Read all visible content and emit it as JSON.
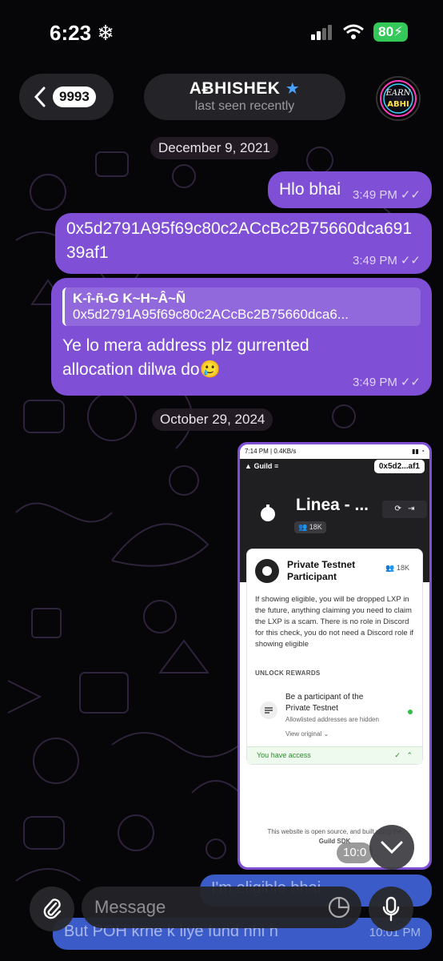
{
  "status_bar": {
    "time": "6:23",
    "battery": "80"
  },
  "header": {
    "back_count": "9993",
    "contact_name": "AɃHISHEK",
    "contact_status": "last seen recently",
    "avatar_text": "EARN ABHI"
  },
  "dates": [
    "December 9, 2021",
    "October 29, 2024"
  ],
  "messages": [
    {
      "text": "Hlo bhai",
      "time": "3:49 PM"
    },
    {
      "text": "0x5d2791A95f69c80c2ACcBc2B75660dca69139af1",
      "time": "3:49 PM"
    },
    {
      "reply_name": "K-î-ñ-G K~H~Â~Ñ",
      "reply_text": "0x5d2791A95f69c80c2ACcBc2B75660dca6...",
      "text": "Ye lo mera address plz gurrented allocation dilwa do🥲",
      "time": "3:49 PM"
    }
  ],
  "image_message": {
    "time": "10:0",
    "screenshot": {
      "status": "7:14 PM | 0.4KB/s",
      "brand": "Guild",
      "address": "0x5d2...af1",
      "guild_name": "Linea - ...",
      "members": "18K",
      "role_title": "Private Testnet Participant",
      "role_count": "18K",
      "role_description": "If showing eligible, you will be dropped LXP in the future, anything claiming you need to claim the LXP is a scam. There is no role in Discord for this check, you do not need a Discord role if showing eligible",
      "unlock_label": "UNLOCK REWARDS",
      "requirement": "Be a participant of the Private Testnet",
      "requirement_sub": "Allowlisted addresses are hidden",
      "view_original": "View original",
      "access_text": "You have access",
      "footer_line1": "This website is open source, and built using the",
      "footer_line2": "Guild SDK"
    }
  },
  "faded_messages": [
    {
      "text": "I'm eligible bhai"
    },
    {
      "text": "But POH krne k liye fund nhi h",
      "time": "10:01 PM"
    }
  ],
  "input": {
    "placeholder": "Message"
  }
}
